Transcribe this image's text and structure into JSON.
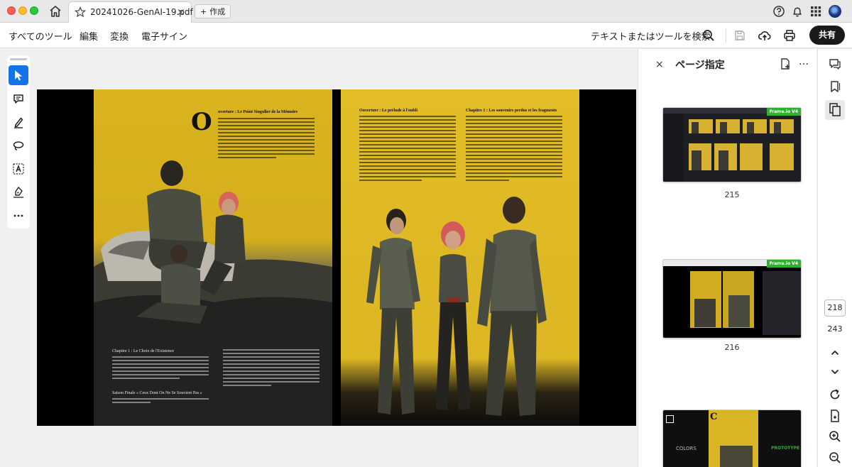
{
  "titlebar": {
    "tab_title": "20241026-GenAI-19.pdf",
    "tab_close": "×",
    "new_tab_plus": "+",
    "new_tab_label": "作成"
  },
  "menubar": {
    "items": [
      "すべてのツール",
      "編集",
      "変換",
      "電子サイン"
    ],
    "search_label": "テキストまたはツールを検索",
    "share_label": "共有"
  },
  "document": {
    "left_page": {
      "drop_cap": "O",
      "heading": "uverture : Le Point Singulier de la Mémoire",
      "col_heading": "Chapitre 1 : Le Choix de l'Existence",
      "footer_heading": "Saison Finale « Ceux Dont On Ne Se Souvient Pas »"
    },
    "right_page": {
      "heading_left": "Ouverture : Le prélude à l'oubli",
      "heading_right": "Chapitre 1 : Les souvenirs perdus et les fragments"
    }
  },
  "side_panel": {
    "close_label": "×",
    "title": "ページ指定",
    "more_label": "…",
    "thumbnails": [
      {
        "label": "215",
        "badge": "Frame.io V4"
      },
      {
        "label": "216",
        "badge": "Frame.io V4"
      },
      {
        "label": "",
        "cover_word": "COLORS",
        "cover_letter": "C",
        "tag": "PROTOTYPE"
      }
    ]
  },
  "page_nav": {
    "current_page": "218",
    "total_pages": "243"
  },
  "colors": {
    "accent": "#1473e6",
    "page_yellow": "#dcb623",
    "badge_green": "#2fb12f",
    "share_bg": "#1a1a1a"
  }
}
